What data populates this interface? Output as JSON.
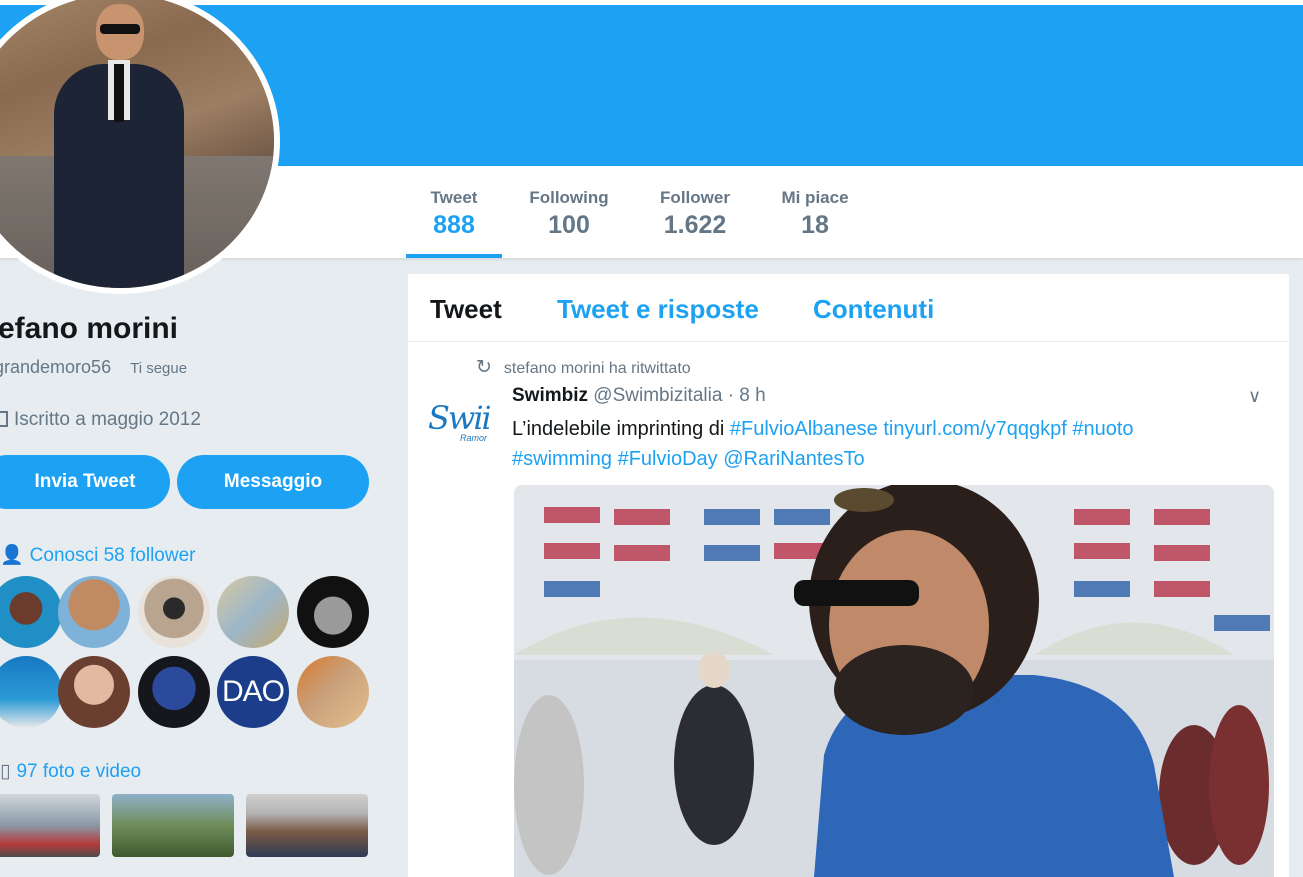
{
  "profile": {
    "name": "tefano morini",
    "handle": "grandemoro56",
    "follows_you": "Ti segue",
    "joined": "Iscritto a maggio 2012",
    "tweet_button": "Invia Tweet",
    "message_button": "Messaggio",
    "followers_you_know": "Conosci 58 follower",
    "photos_videos": "97 foto e video",
    "dao_avatar_text": "DAO"
  },
  "stats": [
    {
      "label": "Tweet",
      "value": "888",
      "active": true
    },
    {
      "label": "Following",
      "value": "100",
      "active": false
    },
    {
      "label": "Follower",
      "value": "1.622",
      "active": false
    },
    {
      "label": "Mi piace",
      "value": "18",
      "active": false
    }
  ],
  "timeline": {
    "tabs": [
      {
        "label": "Tweet",
        "active": true
      },
      {
        "label": "Tweet e risposte",
        "active": false
      },
      {
        "label": "Contenuti",
        "active": false
      }
    ],
    "tweet": {
      "retweet_context": "stefano morini ha ritwittato",
      "author_name": "Swimbiz",
      "author_handle": "@Swimbizitalia",
      "time": "· 8 h",
      "avatar_logo": "Swii",
      "avatar_sub": "Ramor",
      "text_plain": "L’indelebile imprinting di ",
      "link1": "#FulvioAlbanese",
      "link2": "tinyurl.com/y7qqgkpf",
      "link3": "#nuoto",
      "link4": "#swimming",
      "link5": "#FulvioDay",
      "link6": "@RariNantesTo"
    }
  },
  "colors": {
    "accent": "#1da1f2",
    "page_bg": "#e6ecf0",
    "muted": "#657786"
  },
  "icons": {
    "calendar": "calendar-icon",
    "followers": "person-icon",
    "media": "image-icon",
    "retweet": "retweet-icon",
    "caret": "chevron-down-icon"
  }
}
